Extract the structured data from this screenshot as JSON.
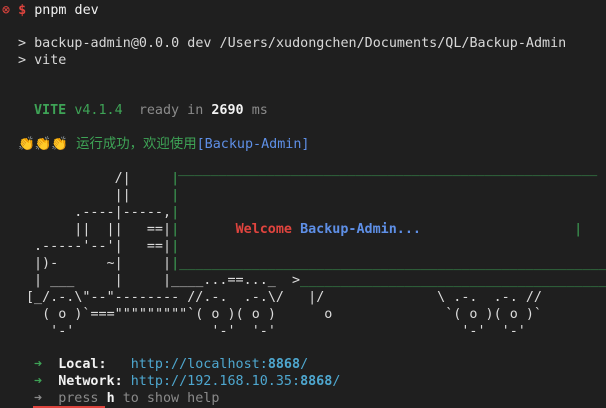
{
  "prompt": {
    "status_icon": "⊗",
    "symbol": "$",
    "command": "pnpm dev"
  },
  "output": {
    "line1": "> backup-admin@0.0.0 dev /Users/xudongchen/Documents/QL/Backup-Admin",
    "line2": "> vite"
  },
  "vite": {
    "name": "VITE",
    "version": "v4.1.4",
    "ready_text": "ready in",
    "ready_ms": "2690",
    "ms_unit": "ms"
  },
  "banner": {
    "emoji": "👏👏👏",
    "message": "运行成功，欢迎使用",
    "app_name": "[Backup-Admin]"
  },
  "truck": {
    "welcome_word": "Welcome",
    "welcome_name": "Backup-Admin..."
  },
  "servers": {
    "local_label": "Local:",
    "local_url_prefix": "http://localhost:",
    "local_port": "8868",
    "local_url_suffix": "/",
    "network_label": "Network:",
    "network_url_prefix": "http://192.168.10.35:",
    "network_port": "8868",
    "network_url_suffix": "/",
    "help_prefix": "press",
    "help_key": "h",
    "help_suffix": "to show help"
  },
  "colors": {
    "background": "#1f1f1f",
    "error_red": "#e0443e",
    "vite_green": "#3ea356",
    "link_blue": "#5e8fe6"
  }
}
